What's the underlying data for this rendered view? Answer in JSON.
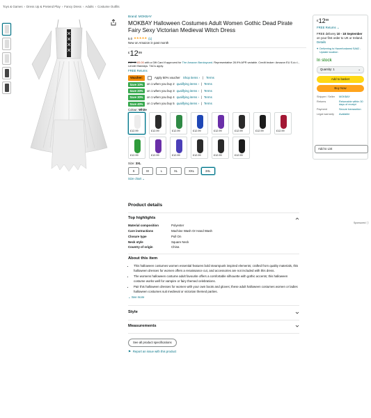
{
  "breadcrumb": [
    "Toys & Games",
    "Dress Up & Pretend Play",
    "Fancy Dress",
    "Adults",
    "Costume Outfits"
  ],
  "breadcrumb_sep": "›",
  "product": {
    "brand": "Brand: MOKBAY",
    "title": "MOKBAY Halloween Costumes Adult Women Gothic Dead Pirate Fairy Sexy Victorian Medieval Witch Dress",
    "rating_value": "5.0",
    "stars": "★★★★★",
    "rating_count": "(1)",
    "new_amazon": "New on Amazon in past month",
    "price_currency": "£",
    "price_whole": "12",
    "price_frac": "99",
    "gift_prefix": "£12.99",
    "gift_strike": "£0.00",
    "gift_text": "with a Gift Card if approved for",
    "gift_link": "The Amazon Barclaycard",
    "gift_text2": ". Representative 28.9% APR variable. Credit broker: Amazon EU S.à.r.l., Lender Barclays. T&Cs apply.",
    "free_returns": "FREE Returns",
    "voucher_badge": "Voucher:",
    "voucher_text": "Apply 50% voucher",
    "voucher_shop": "Shop items ›",
    "voucher_terms": "Terms",
    "save_rows": [
      {
        "badge": "Save 10%",
        "text": "on 1 when you buy 2",
        "link": "qualifying items ›",
        "terms": "Terms"
      },
      {
        "badge": "Save 20%",
        "text": "on 1 when you buy 3",
        "link": "qualifying items ›",
        "terms": "Terms"
      },
      {
        "badge": "Save 30%",
        "text": "on 1 when you buy 4",
        "link": "qualifying items ›",
        "terms": "Terms"
      },
      {
        "badge": "Save 40%",
        "text": "on 1 when you buy 5",
        "link": "qualifying items ›",
        "terms": "Terms"
      }
    ],
    "colour_label": "Colour:",
    "colour_value": "White",
    "swatch_price": "£12.99",
    "swatch_colors": [
      "#ececec",
      "#2b2b2b",
      "#2f8a45",
      "#1f47b5",
      "#6a2fa8",
      "#2a2a2a",
      "#1c1c1c",
      "#a31734",
      "#2e9b3a",
      "#6a2fa8",
      "#4b3fb8",
      "#2b2b2b",
      "#2a2a2a",
      "#1c1c1c"
    ],
    "size_label": "Size:",
    "size_value": "3XL",
    "sizes": [
      "S",
      "M",
      "L",
      "XL",
      "XXL",
      "3XL"
    ],
    "size_chart": "Size chart ⌄"
  },
  "buybox": {
    "price_currency": "£",
    "price_whole": "12",
    "price_frac": "99",
    "free_returns": "FREE Returns ⌄",
    "delivery_prefix": "FREE delivery",
    "delivery_dates": "10 - 18 September",
    "delivery_suffix": "on your first order to UK or Ireland.",
    "delivery_link": "Details",
    "deliver_to": "Delivering to Haverfordwest SA62 - Update location",
    "stock": "In stock",
    "qty": "Quantity: 1",
    "add_basket": "Add to basket",
    "buy_now": "Buy Now",
    "info": [
      {
        "k": "Shipper / Seller",
        "v": "MOKBAY"
      },
      {
        "k": "Returns",
        "v": "Returnable within 30 days of receipt"
      },
      {
        "k": "Payment",
        "v": "Secure transaction"
      },
      {
        "k": "Legal warranty",
        "v": "Available"
      }
    ],
    "add_list": "Add to List"
  },
  "sponsored": "Sponsored ⓘ",
  "details": {
    "title": "Product details",
    "top_highlights": "Top highlights",
    "specs": [
      {
        "k": "Material composition",
        "v": "Polyester"
      },
      {
        "k": "Care instructions",
        "v": "Machine Wash Or Hand Wash"
      },
      {
        "k": "Closure type",
        "v": "Pull On"
      },
      {
        "k": "Neck style",
        "v": "Square Neck"
      },
      {
        "k": "Country of origin",
        "v": "China"
      }
    ],
    "about_title": "About this item",
    "bullets": [
      "This halloween costumes women essential features bold steampunk inspired elements; crafted from quality materials, this halloween dresses for women offers a renaissance cut, and accessories are not included with this dress.",
      "The womens halloween costume adult favourite offers a comfortable silhouette with gothic accents; this halloween costume works well for vampire or fairy themed celebrations.",
      "Pair this halloween dresses for women with your own boots and gloves; these adult halloween costumes women or ladies halloween costumes suit medieval or victorian themed parties."
    ],
    "see_more": "See more",
    "style": "Style",
    "measurements": "Measurements",
    "see_all": "See all product specifications",
    "report": "Report an issue with this product"
  }
}
